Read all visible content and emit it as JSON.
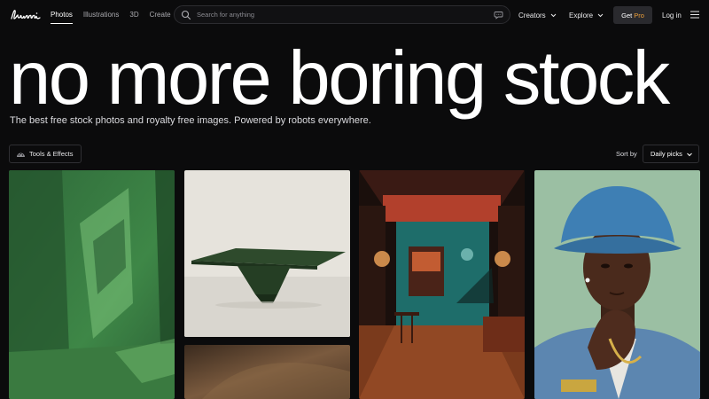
{
  "header": {
    "logo_text": "Lummi",
    "nav": [
      "Photos",
      "Illustrations",
      "3D",
      "Create"
    ],
    "search_placeholder": "Search for anything",
    "creators_label": "Creators",
    "explore_label": "Explore",
    "get_pro": {
      "prefix": "Get",
      "pro": "Pro"
    },
    "login_label": "Log in"
  },
  "hero": {
    "title": "no more boring stock",
    "subtitle": "The best free stock photos and royalty free images. Powered by robots everywhere."
  },
  "toolbar": {
    "tools_label": "Tools & Effects",
    "sort_label": "Sort by",
    "sort_value": "Daily picks"
  },
  "photos": [
    {
      "name": "green-room-shadow-photo"
    },
    {
      "name": "green-table-sculpture-photo"
    },
    {
      "name": "neon-room-interior-photo"
    },
    {
      "name": "man-blue-bucket-hat-photo"
    },
    {
      "name": "brown-texture-photo"
    }
  ]
}
